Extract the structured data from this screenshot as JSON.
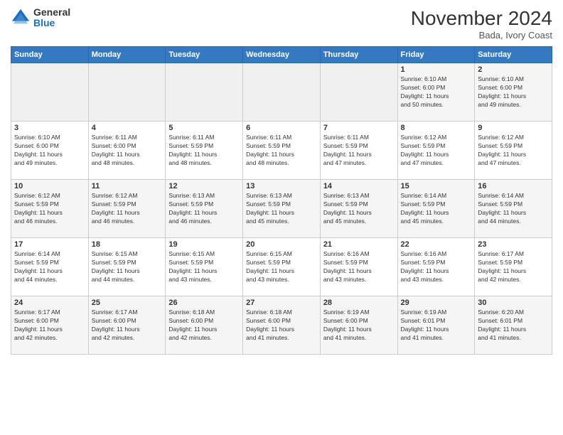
{
  "logo": {
    "general": "General",
    "blue": "Blue"
  },
  "title": "November 2024",
  "location": "Bada, Ivory Coast",
  "days_of_week": [
    "Sunday",
    "Monday",
    "Tuesday",
    "Wednesday",
    "Thursday",
    "Friday",
    "Saturday"
  ],
  "weeks": [
    [
      {
        "day": "",
        "info": ""
      },
      {
        "day": "",
        "info": ""
      },
      {
        "day": "",
        "info": ""
      },
      {
        "day": "",
        "info": ""
      },
      {
        "day": "",
        "info": ""
      },
      {
        "day": "1",
        "info": "Sunrise: 6:10 AM\nSunset: 6:00 PM\nDaylight: 11 hours\nand 50 minutes."
      },
      {
        "day": "2",
        "info": "Sunrise: 6:10 AM\nSunset: 6:00 PM\nDaylight: 11 hours\nand 49 minutes."
      }
    ],
    [
      {
        "day": "3",
        "info": "Sunrise: 6:10 AM\nSunset: 6:00 PM\nDaylight: 11 hours\nand 49 minutes."
      },
      {
        "day": "4",
        "info": "Sunrise: 6:11 AM\nSunset: 6:00 PM\nDaylight: 11 hours\nand 48 minutes."
      },
      {
        "day": "5",
        "info": "Sunrise: 6:11 AM\nSunset: 5:59 PM\nDaylight: 11 hours\nand 48 minutes."
      },
      {
        "day": "6",
        "info": "Sunrise: 6:11 AM\nSunset: 5:59 PM\nDaylight: 11 hours\nand 48 minutes."
      },
      {
        "day": "7",
        "info": "Sunrise: 6:11 AM\nSunset: 5:59 PM\nDaylight: 11 hours\nand 47 minutes."
      },
      {
        "day": "8",
        "info": "Sunrise: 6:12 AM\nSunset: 5:59 PM\nDaylight: 11 hours\nand 47 minutes."
      },
      {
        "day": "9",
        "info": "Sunrise: 6:12 AM\nSunset: 5:59 PM\nDaylight: 11 hours\nand 47 minutes."
      }
    ],
    [
      {
        "day": "10",
        "info": "Sunrise: 6:12 AM\nSunset: 5:59 PM\nDaylight: 11 hours\nand 46 minutes."
      },
      {
        "day": "11",
        "info": "Sunrise: 6:12 AM\nSunset: 5:59 PM\nDaylight: 11 hours\nand 46 minutes."
      },
      {
        "day": "12",
        "info": "Sunrise: 6:13 AM\nSunset: 5:59 PM\nDaylight: 11 hours\nand 46 minutes."
      },
      {
        "day": "13",
        "info": "Sunrise: 6:13 AM\nSunset: 5:59 PM\nDaylight: 11 hours\nand 45 minutes."
      },
      {
        "day": "14",
        "info": "Sunrise: 6:13 AM\nSunset: 5:59 PM\nDaylight: 11 hours\nand 45 minutes."
      },
      {
        "day": "15",
        "info": "Sunrise: 6:14 AM\nSunset: 5:59 PM\nDaylight: 11 hours\nand 45 minutes."
      },
      {
        "day": "16",
        "info": "Sunrise: 6:14 AM\nSunset: 5:59 PM\nDaylight: 11 hours\nand 44 minutes."
      }
    ],
    [
      {
        "day": "17",
        "info": "Sunrise: 6:14 AM\nSunset: 5:59 PM\nDaylight: 11 hours\nand 44 minutes."
      },
      {
        "day": "18",
        "info": "Sunrise: 6:15 AM\nSunset: 5:59 PM\nDaylight: 11 hours\nand 44 minutes."
      },
      {
        "day": "19",
        "info": "Sunrise: 6:15 AM\nSunset: 5:59 PM\nDaylight: 11 hours\nand 43 minutes."
      },
      {
        "day": "20",
        "info": "Sunrise: 6:15 AM\nSunset: 5:59 PM\nDaylight: 11 hours\nand 43 minutes."
      },
      {
        "day": "21",
        "info": "Sunrise: 6:16 AM\nSunset: 5:59 PM\nDaylight: 11 hours\nand 43 minutes."
      },
      {
        "day": "22",
        "info": "Sunrise: 6:16 AM\nSunset: 5:59 PM\nDaylight: 11 hours\nand 43 minutes."
      },
      {
        "day": "23",
        "info": "Sunrise: 6:17 AM\nSunset: 5:59 PM\nDaylight: 11 hours\nand 42 minutes."
      }
    ],
    [
      {
        "day": "24",
        "info": "Sunrise: 6:17 AM\nSunset: 6:00 PM\nDaylight: 11 hours\nand 42 minutes."
      },
      {
        "day": "25",
        "info": "Sunrise: 6:17 AM\nSunset: 6:00 PM\nDaylight: 11 hours\nand 42 minutes."
      },
      {
        "day": "26",
        "info": "Sunrise: 6:18 AM\nSunset: 6:00 PM\nDaylight: 11 hours\nand 42 minutes."
      },
      {
        "day": "27",
        "info": "Sunrise: 6:18 AM\nSunset: 6:00 PM\nDaylight: 11 hours\nand 41 minutes."
      },
      {
        "day": "28",
        "info": "Sunrise: 6:19 AM\nSunset: 6:00 PM\nDaylight: 11 hours\nand 41 minutes."
      },
      {
        "day": "29",
        "info": "Sunrise: 6:19 AM\nSunset: 6:01 PM\nDaylight: 11 hours\nand 41 minutes."
      },
      {
        "day": "30",
        "info": "Sunrise: 6:20 AM\nSunset: 6:01 PM\nDaylight: 11 hours\nand 41 minutes."
      }
    ]
  ]
}
